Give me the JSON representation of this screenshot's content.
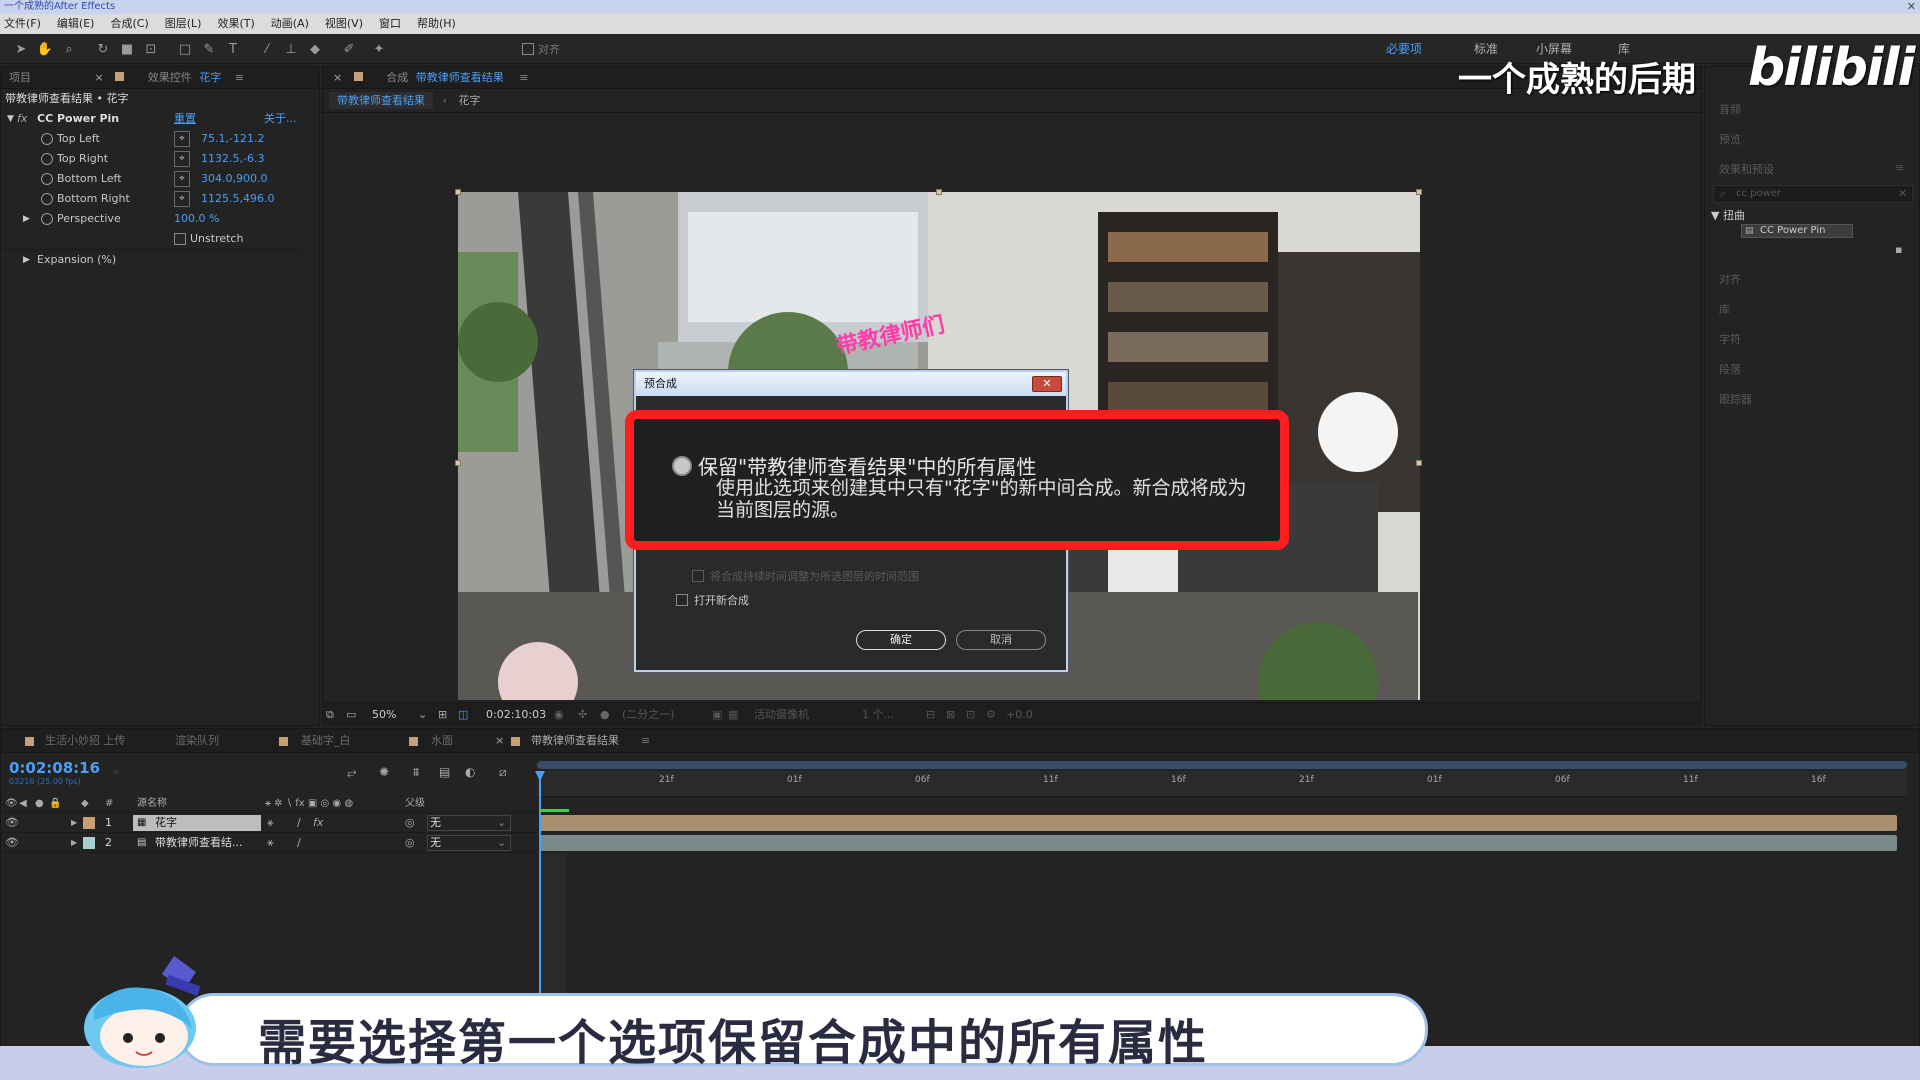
{
  "app": {
    "window_title": "一个成熟的After Effects",
    "accent_color": "#4a9ef4",
    "highlight_color": "#ff1e1e"
  },
  "menu": [
    "文件(F)",
    "编辑(E)",
    "合成(C)",
    "图层(L)",
    "效果(T)",
    "动画(A)",
    "视图(V)",
    "窗口",
    "帮助(H)"
  ],
  "toolbar": {
    "align_label": "对齐",
    "workspaces": [
      "必要项",
      "标准",
      "小屏幕",
      "库"
    ]
  },
  "effect_controls": {
    "tab_project": "项目",
    "tab_label": "效果控件",
    "tab_layer": "花字",
    "breadcrumb": "带教律师查看结果 • 花字",
    "effect_name": "CC Power Pin",
    "reset_label": "重置",
    "about_label": "关于...",
    "params": [
      {
        "name": "Top Left",
        "value": "75.1,-121.2"
      },
      {
        "name": "Top Right",
        "value": "1132.5,-6.3"
      },
      {
        "name": "Bottom Left",
        "value": "304.0,900.0"
      },
      {
        "name": "Bottom Right",
        "value": "1125.5,496.0"
      }
    ],
    "perspective_label": "Perspective",
    "perspective_value": "100.0 %",
    "unstretch_label": "Unstretch",
    "expansion_label": "Expansion (%)"
  },
  "composition": {
    "tab_prefix": "合成",
    "tab_name": "带教律师查看结果",
    "sub_tab_active": "带教律师查看结果",
    "sub_tab_layer": "花字",
    "overlay_text": "带教律师们",
    "zoom": "50%",
    "timecode": "0:02:10:03",
    "resolution": "(二分之一)",
    "camera": "活动摄像机",
    "views": "1 个...",
    "exposure": "+0.0"
  },
  "dialog": {
    "title": "预合成",
    "option_title": "保留\"带教律师查看结果\"中的所有属性",
    "option_desc": "使用此选项来创建其中只有\"花字\"的新中间合成。新合成将成为当前图层的源。",
    "adjust_label": "将合成持续时间调整为所选图层的时间范围",
    "open_label": "打开新合成",
    "ok_label": "确定",
    "cancel_label": "取消"
  },
  "right_panel": {
    "items": [
      "音频",
      "预览",
      "效果和预设",
      "对齐",
      "库",
      "字符",
      "段落",
      "跟踪器"
    ],
    "search_value": "cc power",
    "category": "扭曲",
    "effect_result": "CC Power Pin"
  },
  "timeline": {
    "tabs": [
      "生活小妙招 上传",
      "渲染队列",
      "基础字_白",
      "水面",
      "带教律师查看结果"
    ],
    "timecode": "0:02:08:16",
    "frame_info": "03216 (25.00 fps)",
    "col_source": "源名称",
    "col_parent": "父级",
    "ruler": [
      "21f",
      "01f",
      "06f",
      "11f",
      "16f",
      "21f",
      "01f",
      "06f",
      "11f",
      "16f"
    ],
    "layers": [
      {
        "num": "1",
        "name": "花字",
        "parent": "无",
        "color": "#c8a078"
      },
      {
        "num": "2",
        "name": "带教律师查看结...",
        "parent": "无",
        "color": "#a8d0d0"
      }
    ]
  },
  "watermark": {
    "text": "一个成熟的后期",
    "logo": "bilibili"
  },
  "subtitle": "需要选择第一个选项保留合成中的所有属性"
}
